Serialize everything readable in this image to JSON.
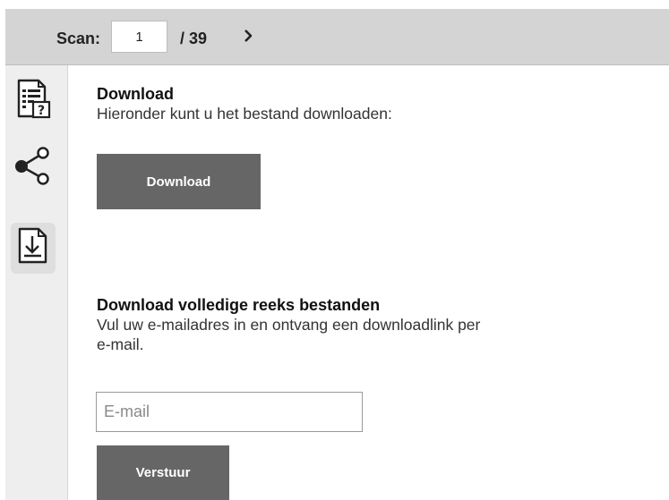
{
  "toolbar": {
    "scan_label": "Scan:",
    "page_value": "1",
    "page_total": "/ 39",
    "next_icon": "chevron-right-icon"
  },
  "sidebar": {
    "items": [
      {
        "icon": "document-info-icon",
        "active": false
      },
      {
        "icon": "share-icon",
        "active": false
      },
      {
        "icon": "download-document-icon",
        "active": true
      }
    ]
  },
  "download": {
    "title": "Download",
    "description": "Hieronder kunt u het bestand downloaden:",
    "button_label": "Download"
  },
  "bulk_download": {
    "title": "Download volledige reeks bestanden",
    "description_line1": "Vul uw e-mailadres in en ontvang een downloadlink per",
    "description_line2": "e-mail.",
    "email_placeholder": "E-mail",
    "submit_label": "Verstuur"
  },
  "colors": {
    "toolbar_bg": "#d4d4d4",
    "sidebar_bg": "#eeeeee",
    "button_bg": "#666666"
  }
}
